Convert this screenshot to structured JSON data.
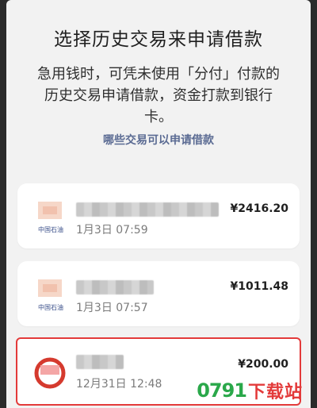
{
  "page": {
    "title": "选择历史交易来申请借款",
    "description": "急用钱时，可凭未使用「分付」付款的历史交易申请借款，资金打款到银行卡。",
    "help_link": "哪些交易可以申请借款"
  },
  "transactions": [
    {
      "date_time": "1月3日 07:59",
      "amount": "¥2416.20",
      "logo_text": "中国石油"
    },
    {
      "date_time": "1月3日 07:57",
      "amount": "¥1011.48",
      "logo_text": "中国石油"
    },
    {
      "date_time": "12月31日 12:48",
      "amount": "¥200.00",
      "selected": true
    }
  ],
  "watermark": {
    "number": "0791",
    "text": "下载站",
    "colors": {
      "number": "#2aa84a",
      "text": "#e33a3a"
    }
  },
  "colors": {
    "accent_link": "#5b6b93",
    "selected_outline": "#e33a3a",
    "background": "#f2f2f2",
    "card": "#ffffff"
  },
  "icons": [
    "fuel-station-logo-icon",
    "merchant-logo-icon"
  ]
}
